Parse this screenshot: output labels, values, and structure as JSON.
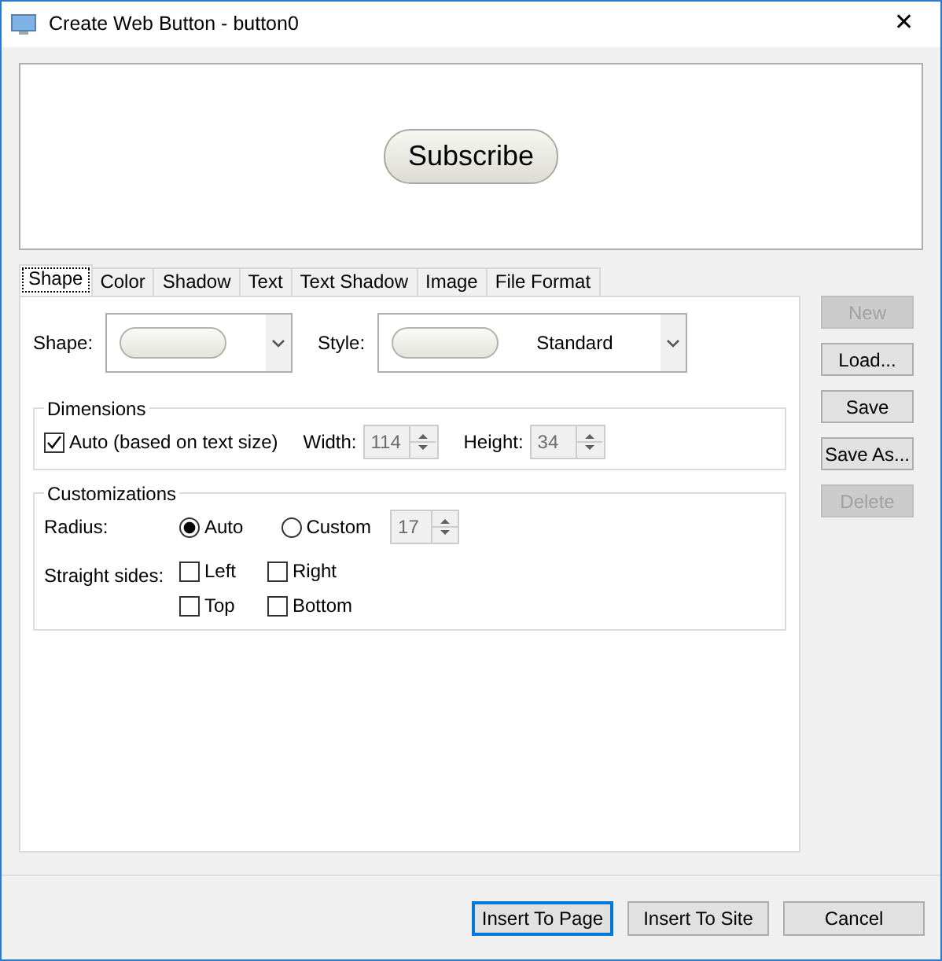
{
  "window": {
    "title": "Create Web Button - button0",
    "close": "✕"
  },
  "preview": {
    "button_text": "Subscribe"
  },
  "tabs": [
    {
      "label": "Shape",
      "selected": true
    },
    {
      "label": "Color",
      "selected": false
    },
    {
      "label": "Shadow",
      "selected": false
    },
    {
      "label": "Text",
      "selected": false
    },
    {
      "label": "Text Shadow",
      "selected": false
    },
    {
      "label": "Image",
      "selected": false
    },
    {
      "label": "File Format",
      "selected": false
    }
  ],
  "shape": {
    "label": "Shape:"
  },
  "style": {
    "label": "Style:",
    "value": "Standard"
  },
  "dimensions": {
    "title": "Dimensions",
    "auto": {
      "label": "Auto (based on text size)",
      "checked": true
    },
    "width": {
      "label": "Width:",
      "value": "114",
      "disabled": true
    },
    "height": {
      "label": "Height:",
      "value": "34",
      "disabled": true
    }
  },
  "customizations": {
    "title": "Customizations",
    "radius_label": "Radius:",
    "radius_options": [
      {
        "label": "Auto",
        "selected": true
      },
      {
        "label": "Custom",
        "selected": false
      }
    ],
    "radius_value": {
      "value": "17",
      "disabled": true
    },
    "straight_sides_label": "Straight sides:",
    "sides": [
      {
        "label": "Left",
        "checked": false
      },
      {
        "label": "Right",
        "checked": false
      },
      {
        "label": "Top",
        "checked": false
      },
      {
        "label": "Bottom",
        "checked": false
      }
    ]
  },
  "side_buttons": [
    {
      "label": "New",
      "disabled": true
    },
    {
      "label": "Load...",
      "disabled": false
    },
    {
      "label": "Save",
      "disabled": false
    },
    {
      "label": "Save As...",
      "disabled": false
    },
    {
      "label": "Delete",
      "disabled": true
    }
  ],
  "footer_buttons": [
    {
      "label": "Insert To Page",
      "default": true
    },
    {
      "label": "Insert To Site",
      "default": false
    },
    {
      "label": "Cancel",
      "default": false
    }
  ]
}
